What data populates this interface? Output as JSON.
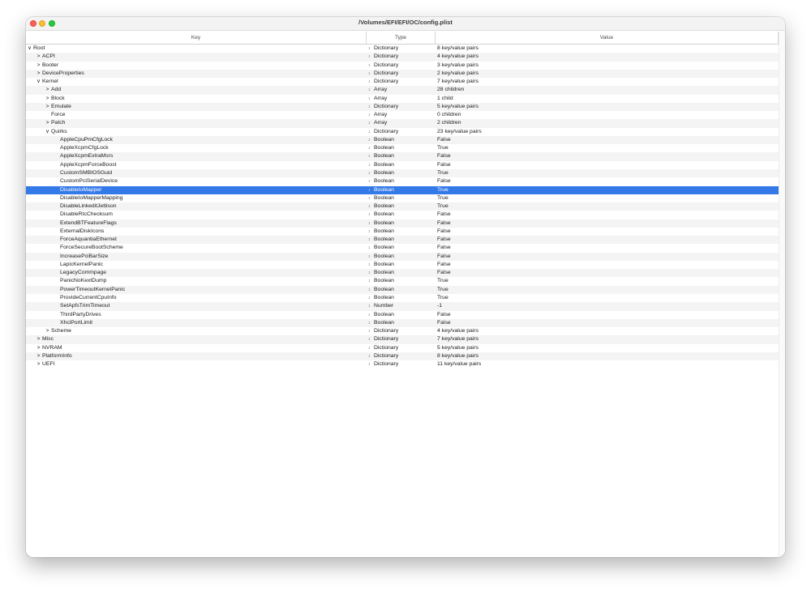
{
  "window": {
    "title": "/Volumes/EFI/EFI/OC/config.plist"
  },
  "columns": {
    "key": "Key",
    "type": "Type",
    "value": "Value"
  },
  "icons": {
    "expanded": "expanded-chevron-icon",
    "collapsed": "collapsed-chevron-icon",
    "stepper": "type-stepper-icon"
  },
  "colors": {
    "selection": "#3479e8",
    "close": "#ff5f57",
    "minimize": "#febc2e",
    "maximize": "#28c840"
  },
  "rows": [
    {
      "key": "Root",
      "type": "",
      "value": "",
      "depth": 0,
      "disclosure": "expanded"
    },
    {
      "key": "ACPI",
      "type": "Dictionary",
      "value": "4 key/value pairs",
      "depth": 1,
      "disclosure": "collapsed"
    },
    {
      "key": "Booter",
      "type": "Dictionary",
      "value": "3 key/value pairs",
      "depth": 1,
      "disclosure": "collapsed"
    },
    {
      "key": "DeviceProperties",
      "type": "Dictionary",
      "value": "2 key/value pairs",
      "depth": 1,
      "disclosure": "collapsed"
    },
    {
      "key": "Kernel",
      "type": "Dictionary",
      "value": "7 key/value pairs",
      "depth": 1,
      "disclosure": "expanded"
    },
    {
      "key": "Add",
      "type": "Array",
      "value": "28 children",
      "depth": 2,
      "disclosure": "collapsed"
    },
    {
      "key": "Block",
      "type": "Array",
      "value": "1 child",
      "depth": 2,
      "disclosure": "collapsed"
    },
    {
      "key": "Emulate",
      "type": "Dictionary",
      "value": "5 key/value pairs",
      "depth": 2,
      "disclosure": "collapsed"
    },
    {
      "key": "Force",
      "type": "Array",
      "value": "0 children",
      "depth": 2,
      "disclosure": "none"
    },
    {
      "key": "Patch",
      "type": "Array",
      "value": "2 children",
      "depth": 2,
      "disclosure": "collapsed"
    },
    {
      "key": "Quirks",
      "type": "Dictionary",
      "value": "23 key/value pairs",
      "depth": 2,
      "disclosure": "expanded"
    },
    {
      "key": "AppleCpuPmCfgLock",
      "type": "Boolean",
      "value": "False",
      "depth": 3,
      "disclosure": "none"
    },
    {
      "key": "AppleXcpmCfgLock",
      "type": "Boolean",
      "value": "True",
      "depth": 3,
      "disclosure": "none"
    },
    {
      "key": "AppleXcpmExtraMsrs",
      "type": "Boolean",
      "value": "False",
      "depth": 3,
      "disclosure": "none"
    },
    {
      "key": "AppleXcpmForceBoost",
      "type": "Boolean",
      "value": "False",
      "depth": 3,
      "disclosure": "none"
    },
    {
      "key": "CustomSMBIOSGuid",
      "type": "Boolean",
      "value": "True",
      "depth": 3,
      "disclosure": "none"
    },
    {
      "key": "CustomPciSerialDevice",
      "type": "Boolean",
      "value": "False",
      "depth": 3,
      "disclosure": "none"
    },
    {
      "key": "DisableIoMapper",
      "type": "Boolean",
      "value": "True",
      "depth": 3,
      "disclosure": "none",
      "selected": true
    },
    {
      "key": "DisableIoMapperMapping",
      "type": "Boolean",
      "value": "True",
      "depth": 3,
      "disclosure": "none"
    },
    {
      "key": "DisableLinkeditJettison",
      "type": "Boolean",
      "value": "True",
      "depth": 3,
      "disclosure": "none"
    },
    {
      "key": "DisableRtcChecksum",
      "type": "Boolean",
      "value": "False",
      "depth": 3,
      "disclosure": "none"
    },
    {
      "key": "ExtendBTFeatureFlags",
      "type": "Boolean",
      "value": "False",
      "depth": 3,
      "disclosure": "none"
    },
    {
      "key": "ExternalDiskIcons",
      "type": "Boolean",
      "value": "False",
      "depth": 3,
      "disclosure": "none"
    },
    {
      "key": "ForceAquantiaEthernet",
      "type": "Boolean",
      "value": "False",
      "depth": 3,
      "disclosure": "none"
    },
    {
      "key": "ForceSecureBootScheme",
      "type": "Boolean",
      "value": "False",
      "depth": 3,
      "disclosure": "none"
    },
    {
      "key": "IncreasePciBarSize",
      "type": "Boolean",
      "value": "False",
      "depth": 3,
      "disclosure": "none"
    },
    {
      "key": "LapicKernelPanic",
      "type": "Boolean",
      "value": "False",
      "depth": 3,
      "disclosure": "none"
    },
    {
      "key": "LegacyCommpage",
      "type": "Boolean",
      "value": "False",
      "depth": 3,
      "disclosure": "none"
    },
    {
      "key": "PanicNoKextDump",
      "type": "Boolean",
      "value": "True",
      "depth": 3,
      "disclosure": "none"
    },
    {
      "key": "PowerTimeoutKernelPanic",
      "type": "Boolean",
      "value": "True",
      "depth": 3,
      "disclosure": "none"
    },
    {
      "key": "ProvideCurrentCpuInfo",
      "type": "Boolean",
      "value": "True",
      "depth": 3,
      "disclosure": "none"
    },
    {
      "key": "SetApfsTrimTimeout",
      "type": "Number",
      "value": "-1",
      "depth": 3,
      "disclosure": "none"
    },
    {
      "key": "ThirdPartyDrives",
      "type": "Boolean",
      "value": "False",
      "depth": 3,
      "disclosure": "none"
    },
    {
      "key": "XhciPortLimit",
      "type": "Boolean",
      "value": "False",
      "depth": 3,
      "disclosure": "none"
    },
    {
      "key": "Scheme",
      "type": "Dictionary",
      "value": "4 key/value pairs",
      "depth": 2,
      "disclosure": "collapsed"
    },
    {
      "key": "Misc",
      "type": "Dictionary",
      "value": "7 key/value pairs",
      "depth": 1,
      "disclosure": "collapsed"
    },
    {
      "key": "NVRAM",
      "type": "Dictionary",
      "value": "5 key/value pairs",
      "depth": 1,
      "disclosure": "collapsed"
    },
    {
      "key": "PlatformInfo",
      "type": "Dictionary",
      "value": "8 key/value pairs",
      "depth": 1,
      "disclosure": "collapsed"
    },
    {
      "key": "UEFI",
      "type": "Dictionary",
      "value": "11 key/value pairs",
      "depth": 1,
      "disclosure": "collapsed"
    }
  ],
  "root_summary": {
    "type": "Dictionary",
    "value": "8 key/value pairs"
  }
}
